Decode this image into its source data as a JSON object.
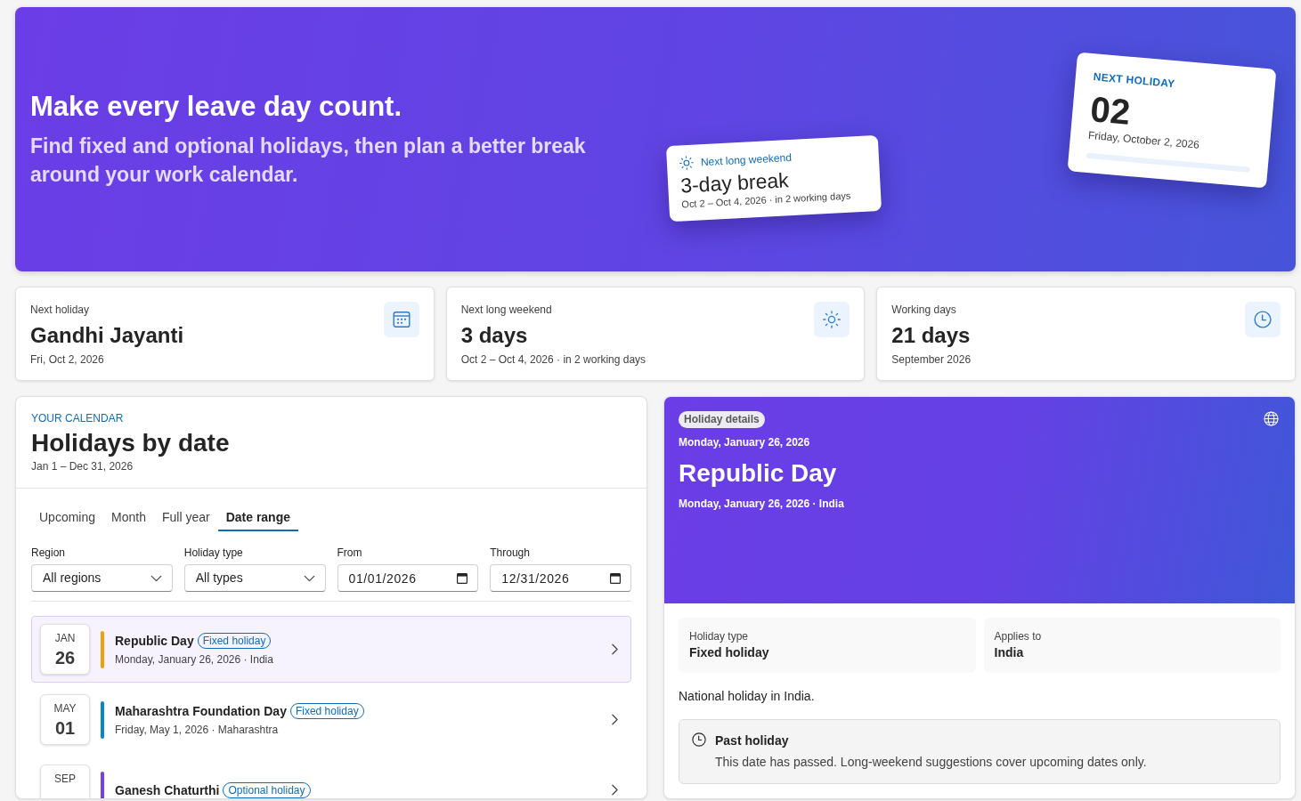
{
  "hero": {
    "title": "Make every leave day count.",
    "subtitle": "Find fixed and optional holidays, then plan a better break around your work calendar.",
    "weekend_card": {
      "label": "Next long weekend",
      "title": "3-day break",
      "detail": "Oct 2 – Oct 4, 2026 · in 2 working days"
    },
    "holiday_card": {
      "label": "NEXT HOLIDAY",
      "day": "02",
      "date": "Friday, October 2, 2026",
      "level": 0
    }
  },
  "stats": [
    {
      "kind": "holiday",
      "label": "Next holiday",
      "value": "Gandhi Jayanti",
      "detail": "Fri, Oct 2, 2026"
    },
    {
      "kind": "long_weekend",
      "label": "Next long weekend",
      "value": "3 days",
      "detail": "Oct 2 – Oct 4, 2026 · in 2 working days"
    },
    {
      "kind": "working_days",
      "label": "Working days",
      "value": "21 days",
      "detail": "September 2026"
    }
  ],
  "calendar": {
    "eyebrow": "YOUR CALENDAR",
    "title": "Holidays by date",
    "range": "Jan 1 – Dec 31, 2026",
    "tabs": [
      {
        "label": "Upcoming",
        "selected": false
      },
      {
        "label": "Month",
        "selected": false
      },
      {
        "label": "Full year",
        "selected": false
      },
      {
        "label": "Date range",
        "selected": true
      }
    ],
    "filters": [
      {
        "kind": "select",
        "label": "Region",
        "value": "All regions"
      },
      {
        "kind": "select",
        "label": "Holiday type",
        "value": "All types"
      },
      {
        "kind": "date",
        "label": "From",
        "value": "01/01/2026"
      },
      {
        "kind": "date",
        "label": "Through",
        "value": "12/31/2026"
      }
    ],
    "holidays": [
      {
        "month": "JAN",
        "day": "26",
        "name": "Republic Day",
        "badge": "Fixed holiday",
        "detail": "Monday, January 26, 2026 · India",
        "color": "#f59e0b",
        "selected": true
      },
      {
        "month": "MAY",
        "day": "01",
        "name": "Maharashtra Foundation Day",
        "badge": "Fixed holiday",
        "detail": "Friday, May 1, 2026 · Maharashtra",
        "color": "#0a84cc",
        "selected": false
      },
      {
        "month": "SEP",
        "name": "Ganesh Chaturthi",
        "badge": "Optional holiday",
        "color": "#7a3ee6",
        "selected": false
      }
    ]
  },
  "details": {
    "badge": "Holiday details",
    "date": "Monday, January 26, 2026",
    "title": "Republic Day",
    "subtitle": "Monday, January 26, 2026 · India",
    "facts": [
      {
        "label": "Holiday type",
        "value": "Fixed holiday"
      },
      {
        "label": "Applies to",
        "value": "India"
      }
    ],
    "description": "National holiday in India.",
    "notice": {
      "title": "Past holiday",
      "text": "This date has passed. Long-weekend suggestions cover upcoming dates only."
    }
  }
}
